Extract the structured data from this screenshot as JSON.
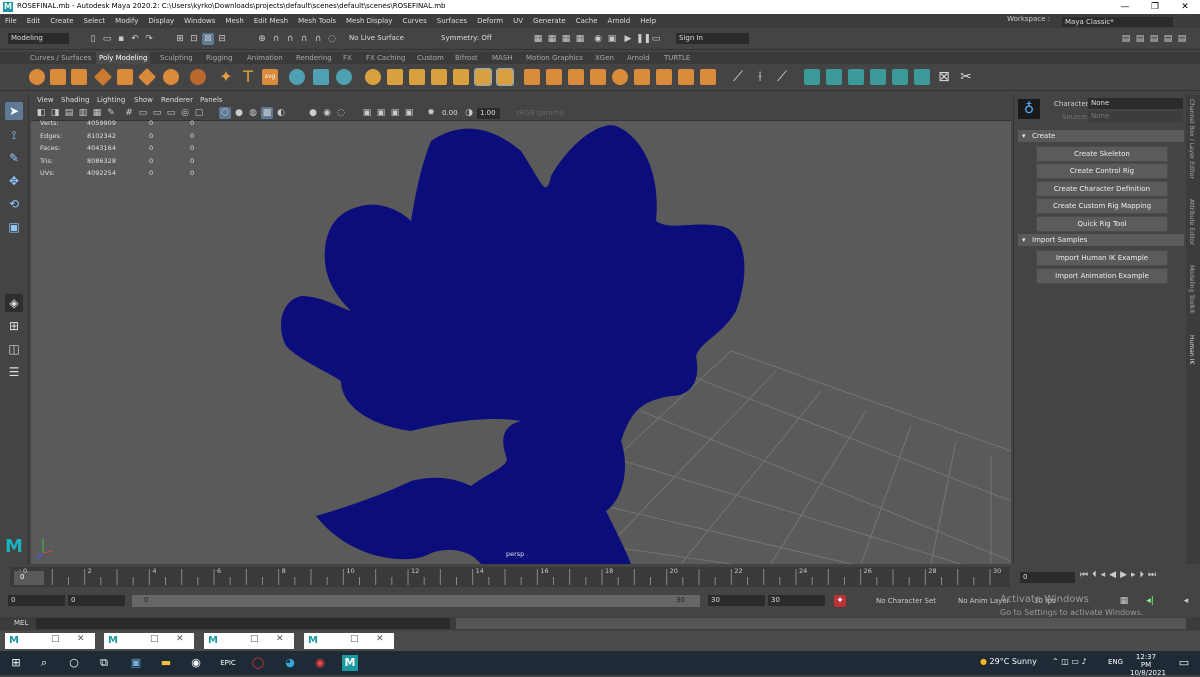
{
  "window": {
    "title": "ROSEFINAL.mb - Autodesk Maya 2020.2: C:\\Users\\kyrko\\Downloads\\projects\\default\\scenes\\default\\scenes\\ROSEFINAL.mb",
    "logo_letter": "M",
    "minimize": "—",
    "maximize": "❐",
    "close": "✕"
  },
  "menu": [
    "File",
    "Edit",
    "Create",
    "Select",
    "Modify",
    "Display",
    "Windows",
    "Mesh",
    "Edit Mesh",
    "Mesh Tools",
    "Mesh Display",
    "Curves",
    "Surfaces",
    "Deform",
    "UV",
    "Generate",
    "Cache",
    "Arnold",
    "Help"
  ],
  "workspace": {
    "label": "Workspace :",
    "value": "Maya Classic*"
  },
  "statusline": {
    "mode": "Modeling",
    "live_surface": "No Live Surface",
    "symmetry": "Symmetry: Off",
    "sign_in": "Sign In"
  },
  "shelf_tabs": [
    "Curves / Surfaces",
    "Poly Modeling",
    "Sculpting",
    "Rigging",
    "Animation",
    "Rendering",
    "FX",
    "FX Caching",
    "Custom",
    "Bifrost",
    "MASH",
    "Motion Graphics",
    "XGen",
    "Arnold",
    "TURTLE"
  ],
  "shelf_active": "Poly Modeling",
  "viewport_menu": [
    "View",
    "Shading",
    "Lighting",
    "Show",
    "Renderer",
    "Panels"
  ],
  "viewport_fields": {
    "near": "0.00",
    "far": "1.00",
    "color_space": "sRGB gamma"
  },
  "hud": [
    {
      "label": "Verts:",
      "a": "4059909",
      "b": "0",
      "c": "0"
    },
    {
      "label": "Edges:",
      "a": "8102342",
      "b": "0",
      "c": "0"
    },
    {
      "label": "Faces:",
      "a": "4043164",
      "b": "0",
      "c": "0"
    },
    {
      "label": "Tris:",
      "a": "8086328",
      "b": "0",
      "c": "0"
    },
    {
      "label": "UVs:",
      "a": "4092254",
      "b": "0",
      "c": "0"
    }
  ],
  "camera_label": "persp",
  "hik": {
    "character_label": "Character:",
    "character_value": "None",
    "source_label": "Source:",
    "source_value": "None",
    "create_header": "Create",
    "create_buttons": [
      "Create Skeleton",
      "Create Control Rig",
      "Create Character Definition",
      "Create Custom Rig Mapping",
      "Quick Rig Tool"
    ],
    "import_header": "Import Samples",
    "import_buttons": [
      "Import Human IK Example",
      "Import Animation Example"
    ]
  },
  "side_tabs": [
    "Channel Box / Layer Editor",
    "Attribute Editor",
    "Modeling Toolkit",
    "Human IK"
  ],
  "timeline": {
    "ticks": [
      "0",
      "2",
      "4",
      "6",
      "8",
      "10",
      "12",
      "14",
      "16",
      "18",
      "20",
      "22",
      "24",
      "26",
      "28",
      "30"
    ],
    "current_frame": "0",
    "current_field": "0"
  },
  "range": {
    "start": "0",
    "anim_start": "0",
    "range_start_field": "0",
    "range_end_field": "30",
    "anim_end": "30",
    "end": "30",
    "character_set": "No Character Set",
    "anim_layer": "No Anim Layer",
    "fps": "30 fps"
  },
  "mel_label": "MEL",
  "activate": {
    "line1": "Activate Windows",
    "line2": "Go to Settings to activate Windows."
  },
  "taskbar": {
    "weather": "29°C  Sunny",
    "lang": "ENG",
    "time": "12:37 PM",
    "date": "10/8/2021"
  }
}
